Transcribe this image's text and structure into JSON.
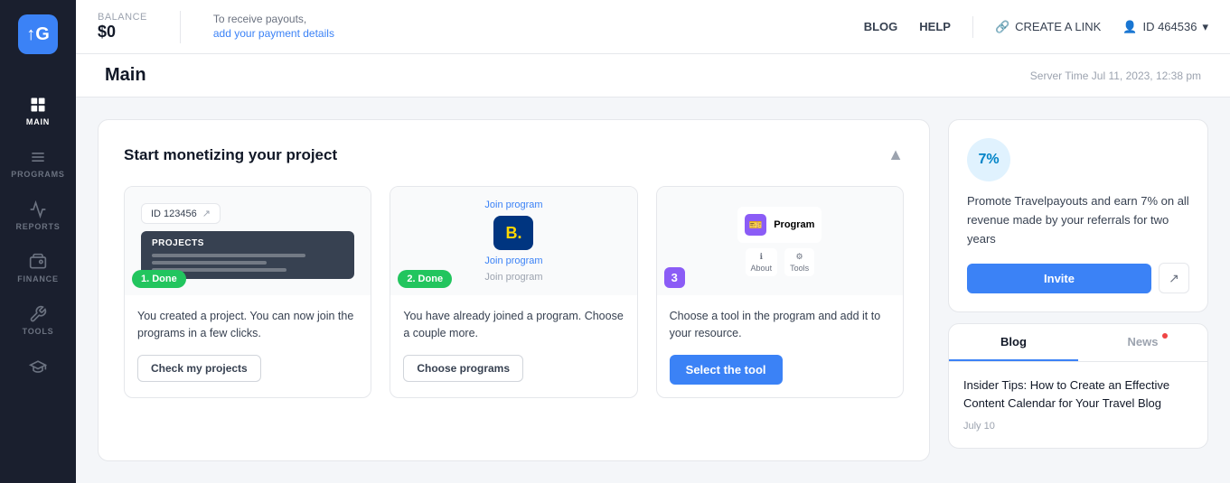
{
  "sidebar": {
    "logo": "↑G",
    "items": [
      {
        "id": "main",
        "label": "MAIN",
        "icon": "grid",
        "active": true
      },
      {
        "id": "programs",
        "label": "PROGRAMS",
        "icon": "list",
        "active": false
      },
      {
        "id": "reports",
        "label": "REPORTS",
        "icon": "chart",
        "active": false
      },
      {
        "id": "finance",
        "label": "FINANCE",
        "icon": "wallet",
        "active": false
      },
      {
        "id": "tools",
        "label": "TooLS",
        "icon": "wrench",
        "active": false
      },
      {
        "id": "education",
        "label": "",
        "icon": "graduation",
        "active": false
      }
    ]
  },
  "topbar": {
    "balance_label": "Balance",
    "balance_amount": "$0",
    "payout_text": "To receive payouts,",
    "payout_link": "add your payment details",
    "blog_label": "BLOG",
    "help_label": "HELP",
    "create_link_label": "CREATE A LINK",
    "user_id": "ID 464536"
  },
  "page": {
    "title": "Main",
    "server_time": "Server Time Jul 11, 2023, 12:38 pm"
  },
  "monetize_section": {
    "title": "Start monetizing your project",
    "steps": [
      {
        "badge": "1. Done",
        "badge_type": "done",
        "description": "You created a project. You can now join the programs in a few clicks.",
        "button_label": "Check my projects",
        "button_type": "outline"
      },
      {
        "badge": "2. Done",
        "badge_type": "done",
        "description": "You have already joined a program. Choose a couple more.",
        "button_label": "Choose programs",
        "button_type": "outline"
      },
      {
        "badge": "3",
        "badge_type": "number",
        "description": "Choose a tool in the program and add it to your resource.",
        "button_label": "Select the tool",
        "button_type": "primary"
      }
    ]
  },
  "promo": {
    "percent": "7%",
    "text": "Promote Travelpayouts and earn 7% on all revenue made by your referrals for two years",
    "invite_label": "Invite"
  },
  "blog_news": {
    "blog_tab": "Blog",
    "news_tab": "News",
    "active_tab": "blog",
    "article_title": "Insider Tips: How to Create an Effective Content Calendar for Your Travel Blog",
    "article_date": "July 10"
  }
}
